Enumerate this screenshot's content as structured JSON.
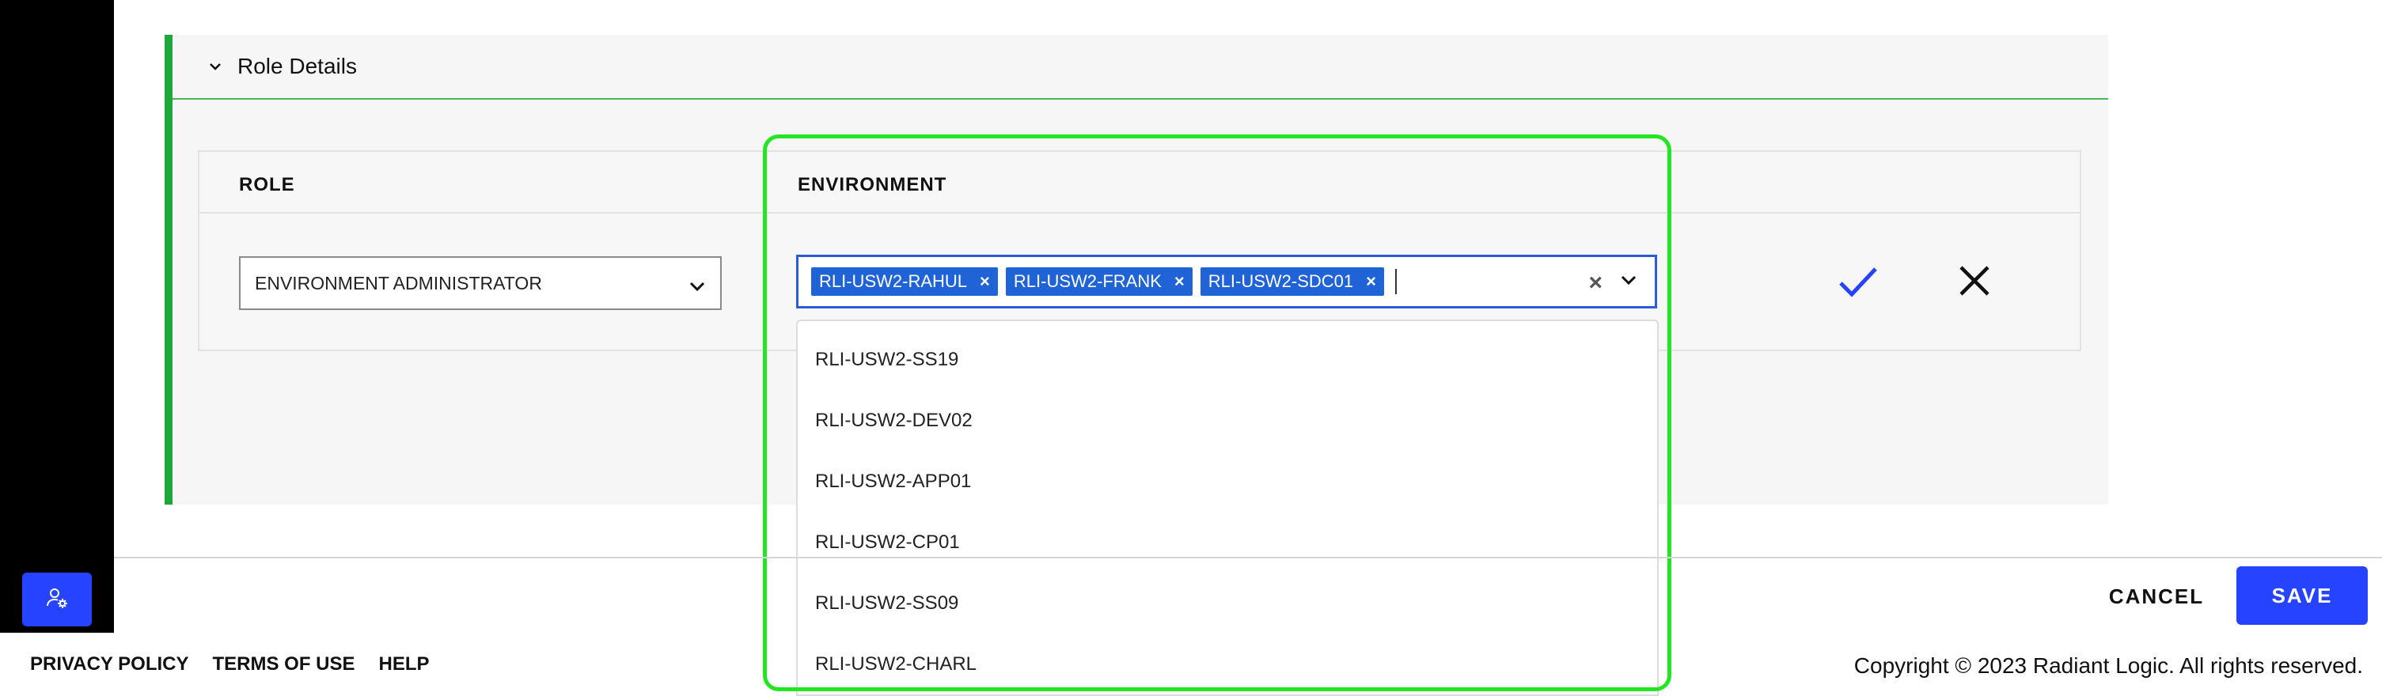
{
  "panel": {
    "title": "Role Details"
  },
  "table": {
    "columns": [
      "ROLE",
      "ENVIRONMENT"
    ],
    "role_value": "ENVIRONMENT ADMINISTRATOR",
    "selected_environments": [
      "RLI-USW2-RAHUL",
      "RLI-USW2-FRANK",
      "RLI-USW2-SDC01"
    ],
    "chip_remove_glyph": "×",
    "clear_glyph": "×"
  },
  "dropdown": {
    "options": [
      "RLI-USW2-SS19",
      "RLI-USW2-DEV02",
      "RLI-USW2-APP01",
      "RLI-USW2-CP01",
      "RLI-USW2-SS09",
      "RLI-USW2-CHARL"
    ]
  },
  "actions": {
    "cancel_label": "CANCEL",
    "save_label": "SAVE"
  },
  "footer": {
    "links": [
      "PRIVACY POLICY",
      "TERMS OF USE",
      "HELP"
    ],
    "copyright": "Copyright © 2023 Radiant Logic. All rights reserved."
  },
  "icons": {
    "rail_button": "user-settings-icon",
    "confirm": "check-icon",
    "discard": "close-icon"
  },
  "colors": {
    "accent": "#2643ff",
    "chip": "#1f63d6",
    "panel_bar": "#1fa83a",
    "highlight": "#22e622"
  }
}
